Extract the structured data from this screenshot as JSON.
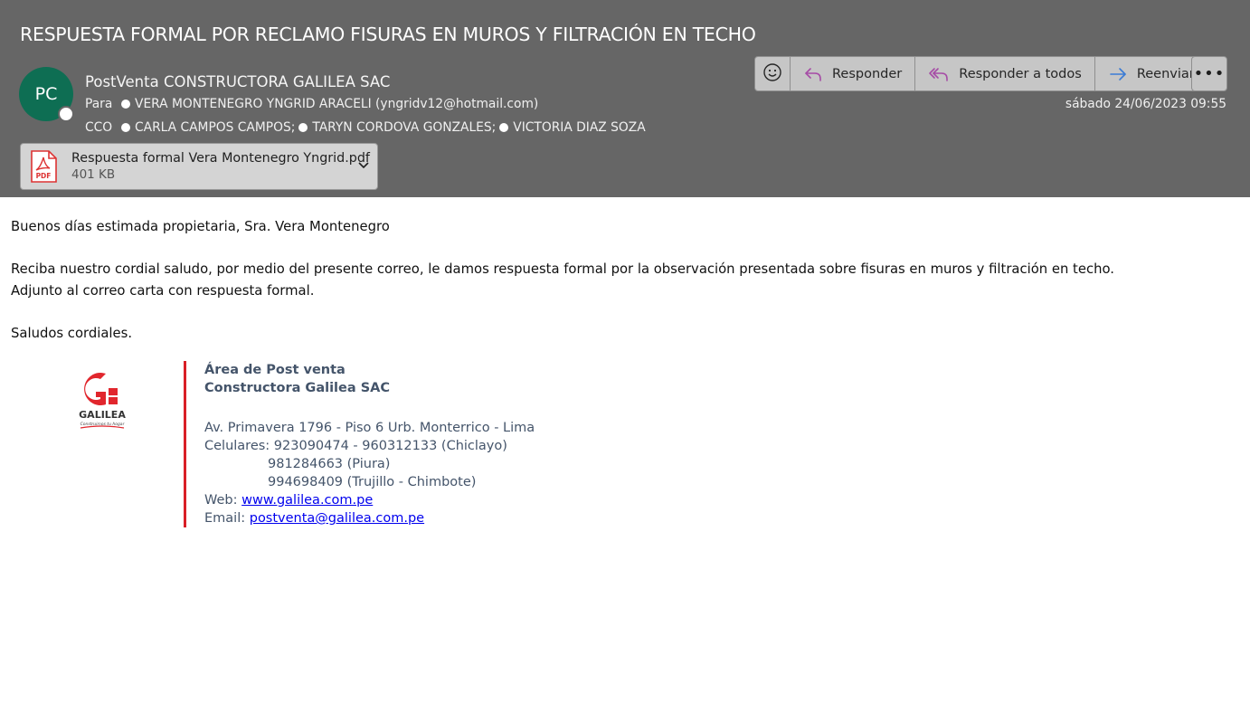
{
  "email": {
    "subject": "RESPUESTA FORMAL POR RECLAMO FISURAS EN MUROS Y FILTRACIÓN EN TECHO",
    "avatar_initials": "PC",
    "sender": "PostVenta CONSTRUCTORA GALILEA SAC",
    "to_label": "Para",
    "to": "VERA MONTENEGRO YNGRID ARACELI (yngridv12@hotmail.com)",
    "cc_label": "CCO",
    "cc": [
      "CARLA CAMPOS CAMPOS;",
      "TARYN CORDOVA GONZALES;",
      "VICTORIA DIAZ SOZA"
    ],
    "date": "sábado 24/06/2023 09:55"
  },
  "actions": {
    "reply": "Responder",
    "reply_all": "Responder a todos",
    "forward": "Reenviar"
  },
  "attachment": {
    "name": "Respuesta formal Vera Montenegro Yngrid.pdf",
    "size": "401 KB",
    "icon_text": "PDF"
  },
  "body": {
    "greeting": "Buenos días estimada propietaria, Sra. Vera Montenegro",
    "line1": "Reciba nuestro cordial saludo, por medio del presente correo, le damos respuesta formal por la observación presentada sobre fisuras en muros y filtración en techo.",
    "line2": "Adjunto al correo carta con respuesta formal.",
    "closing": "Saludos cordiales."
  },
  "signature": {
    "logo_text": "GALILEA",
    "logo_tagline": "Construimos tu hogar",
    "area": "Área de Post venta",
    "company": "Constructora Galilea SAC",
    "address": "Av. Primavera 1796 - Piso 6 Urb. Monterrico - Lima",
    "phones_label": "Celulares: 923090474 - 960312133 (Chiclayo)",
    "phone2": "981284663 (Piura)",
    "phone3": "994698409 (Trujillo - Chimbote)",
    "web_label": "Web: ",
    "web": "www.galilea.com.pe",
    "email_label": "Email: ",
    "email": "postventa@galilea.com.pe"
  },
  "colors": {
    "header_bg": "#666666",
    "avatar_bg": "#0e6e53",
    "accent_red": "#d91f26",
    "reply_icon": "#a64ca6",
    "forward_icon": "#3a7bd5",
    "signature_text": "#44546a"
  },
  "icons": {
    "emoji": "smiley-icon",
    "reply": "reply-arrow-icon",
    "reply_all": "reply-all-arrow-icon",
    "forward": "forward-arrow-icon",
    "more": "more-icon",
    "attachment": "pdf-file-icon",
    "chevron": "chevron-down-icon"
  }
}
